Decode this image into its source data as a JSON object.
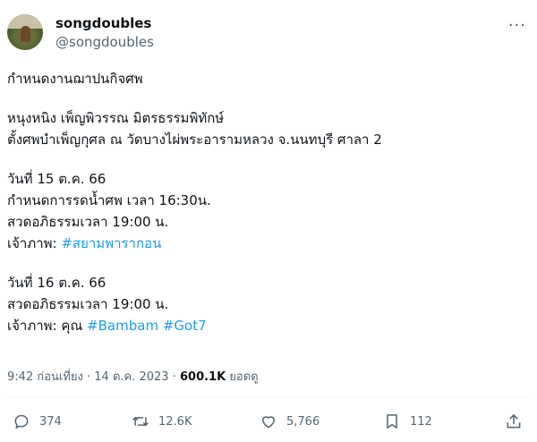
{
  "tweet": {
    "author": {
      "display_name": "songdoubles",
      "handle": "@songdoubles"
    },
    "more_icon": "more-horizontal-icon",
    "paragraphs": [
      {
        "lines": [
          [
            "กำหนดงานฌาปนกิจศพ"
          ]
        ]
      },
      {
        "lines": [
          [
            "หนุงหนิง เพ็ญพิวรรณ มิตรธรรมพิทักษ์"
          ],
          [
            "ตั้งศพบำเพ็ญกุศล ณ วัดบางไผ่พระอารามหลวง  จ.นนทบุรี ศาลา 2"
          ]
        ]
      },
      {
        "lines": [
          [
            "วันที่ 15 ต.ค. 66"
          ],
          [
            "กำหนดการรดน้ำศพ เวลา 16:30น."
          ],
          [
            "สวดอภิธรรมเวลา 19:00 น."
          ],
          [
            "เจ้าภาพ: ",
            "#สยามพารากอน"
          ]
        ]
      },
      {
        "lines": [
          [
            "วันที่ 16 ต.ค. 66"
          ],
          [
            "สวดอภิธรรมเวลา 19:00 น."
          ],
          [
            "เจ้าภาพ: คุณ ",
            "#Bambam",
            " ",
            "#Got7"
          ]
        ]
      }
    ],
    "meta": {
      "time": "9:42 ก่อนเที่ยง",
      "separator": " · ",
      "date": "14 ต.ค. 2023",
      "views_count": "600.1K",
      "views_label": " ยอดดู"
    },
    "actions": {
      "reply": {
        "icon": "reply-icon",
        "count": "374"
      },
      "retweet": {
        "icon": "retweet-icon",
        "count": "12.6K"
      },
      "like": {
        "icon": "heart-icon",
        "count": "5,766"
      },
      "bookmark": {
        "icon": "bookmark-icon",
        "count": "112"
      },
      "share": {
        "icon": "share-icon"
      }
    }
  },
  "colors": {
    "text": "#0f1419",
    "secondary": "#536471",
    "hashtag": "#1d9bf0"
  }
}
